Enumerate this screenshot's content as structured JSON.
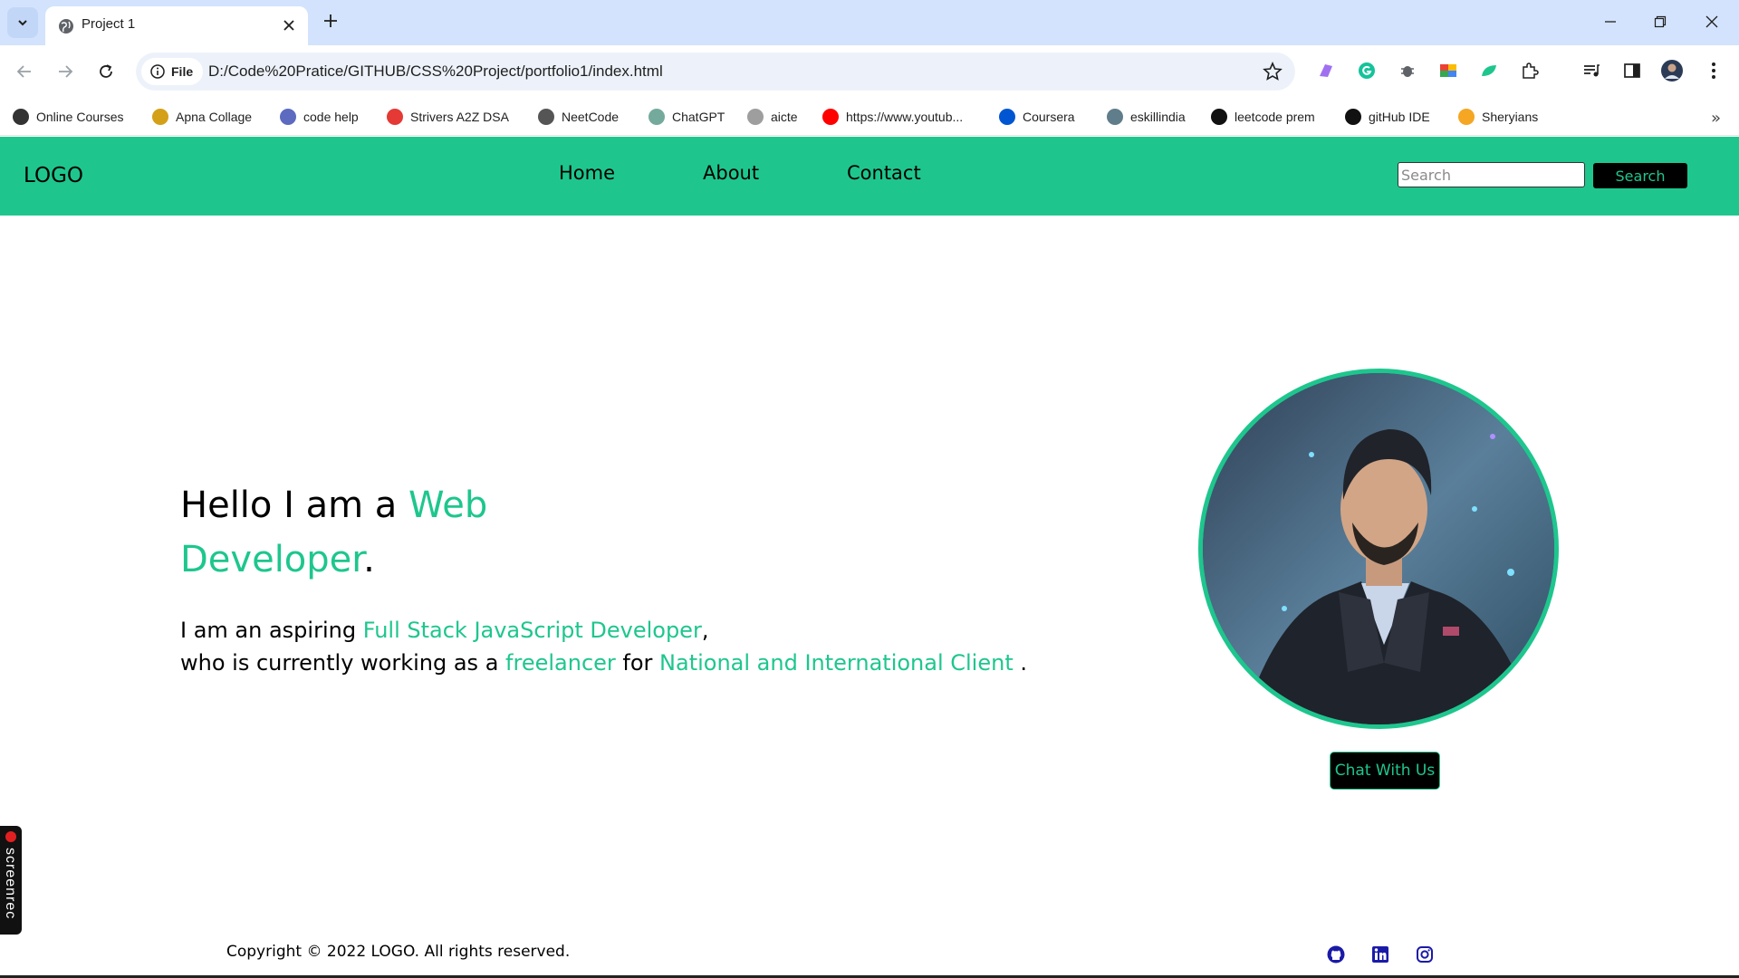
{
  "browser": {
    "tab": {
      "title": "Project 1",
      "favicon": "globe-icon"
    },
    "omnibox": {
      "chip_label": "File",
      "url": "D:/Code%20Pratice/GITHUB/CSS%20Project/portfolio1/index.html"
    },
    "bookmarks": [
      {
        "label": "Online Courses",
        "icon": "online-courses-icon",
        "color": "#333333"
      },
      {
        "label": "Apna Collage",
        "icon": "apna-collage-icon",
        "color": "#d4a017"
      },
      {
        "label": "code help",
        "icon": "code-help-icon",
        "color": "#5c6bc0"
      },
      {
        "label": "Strivers A2Z DSA",
        "icon": "striver-icon",
        "color": "#e53935"
      },
      {
        "label": "NeetCode",
        "icon": "neetcode-icon",
        "color": "#555555"
      },
      {
        "label": "ChatGPT",
        "icon": "chatgpt-icon",
        "color": "#74aa9c"
      },
      {
        "label": "aicte",
        "icon": "aicte-icon",
        "color": "#9e9e9e"
      },
      {
        "label": "https://www.youtub...",
        "icon": "youtube-icon",
        "color": "#ff0000"
      },
      {
        "label": "Coursera",
        "icon": "coursera-icon",
        "color": "#0056d2"
      },
      {
        "label": "eskillindia",
        "icon": "eskillindia-icon",
        "color": "#607d8b"
      },
      {
        "label": "leetcode prem",
        "icon": "github-icon",
        "color": "#111111"
      },
      {
        "label": "gitHub IDE",
        "icon": "github-icon",
        "color": "#111111"
      },
      {
        "label": "Sheryians",
        "icon": "sheryians-icon",
        "color": "#f5a623"
      }
    ]
  },
  "site": {
    "logo": "LOGO",
    "nav": [
      "Home",
      "About",
      "Contact"
    ],
    "search": {
      "placeholder": "Search",
      "button": "Search"
    },
    "hero": {
      "heading_prefix": "Hello I am a ",
      "heading_accent": "Web Developer",
      "heading_suffix": ".",
      "line1_prefix": "I am an aspiring ",
      "line1_accent": "Full Stack JavaScript Developer",
      "line1_suffix": ",",
      "line2_prefix": "who is currently working as a ",
      "line2_accent1": "freelancer",
      "line2_mid": " for ",
      "line2_accent2": "National and International Client",
      "line2_suffix": " ."
    },
    "chat_button": "Chat With Us",
    "footer": {
      "copyright": "Copyright © 2022 LOGO. All rights reserved.",
      "social": [
        "github-icon",
        "linkedin-icon",
        "instagram-icon"
      ]
    },
    "accent_color": "#1ec68e"
  },
  "overlay": {
    "screenrec_label": "screenrec"
  }
}
